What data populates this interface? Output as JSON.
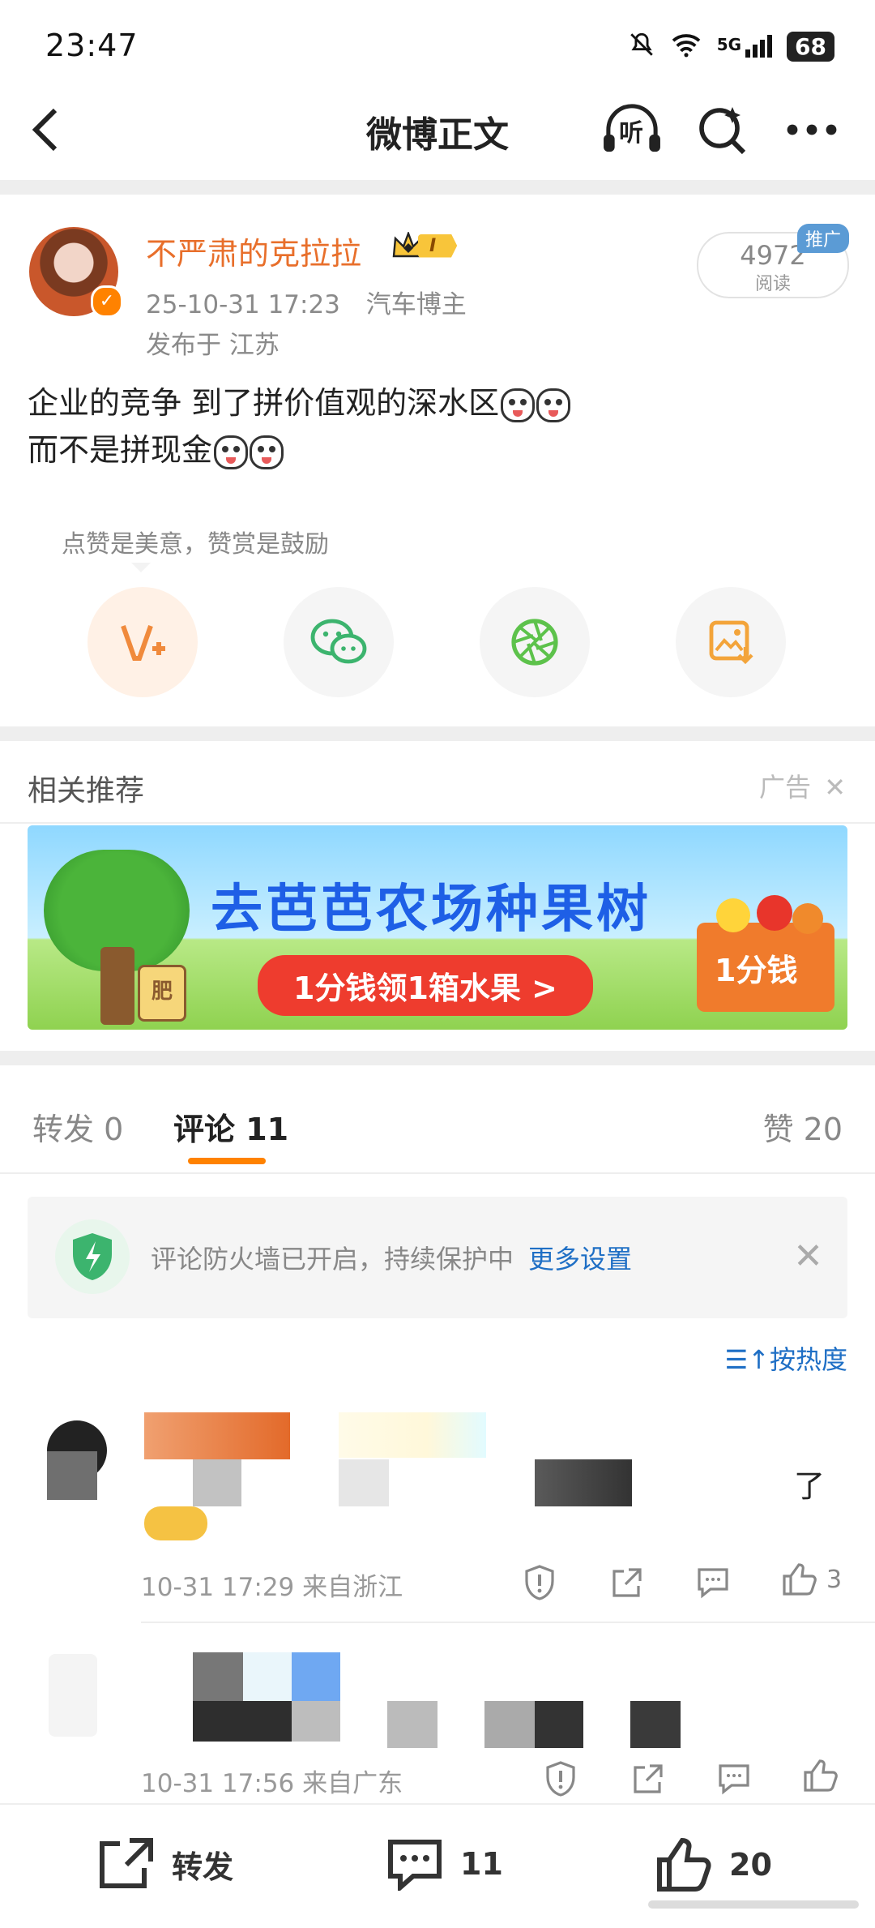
{
  "status_bar": {
    "time": "23:47",
    "network": "5G",
    "battery": "68"
  },
  "nav": {
    "title": "微博正文",
    "listen_label": "听"
  },
  "post": {
    "username": "不严肃的克拉拉",
    "rank_badge": "I",
    "date": "25-10-31 17:23",
    "role": "汽车博主",
    "location": "发布于 江苏",
    "reads": "4972",
    "reads_label": "阅读",
    "promo_tag": "推广",
    "text_line1": "企业的竞争 到了拼价值观的深水区",
    "text_line2": "而不是拼现金",
    "tip": "点赞是美意，赞赏是鼓励"
  },
  "related": {
    "title": "相关推荐",
    "ad_label": "广告",
    "banner_title": "去芭芭农场种果树",
    "banner_button": "1分钱领1箱水果 >",
    "banner_box": "1分钱",
    "banner_pot_label": "肥"
  },
  "tabs": {
    "repost": "转发 0",
    "comments": "评论 11",
    "likes": "赞 20"
  },
  "firewall": {
    "text": "评论防火墙已开启，持续保护中",
    "link": "更多设置"
  },
  "sort_label": "按热度",
  "comments": [
    {
      "meta": "10-31 17:29  来自浙江",
      "likes": "3",
      "trailing_text": "了"
    },
    {
      "meta": "10-31 17:56  来自广东",
      "likes": ""
    }
  ],
  "bottom_bar": {
    "repost": "转发",
    "comments": "11",
    "likes": "20"
  },
  "colors": {
    "accent_orange": "#ff8200",
    "username_orange": "#e86f2b",
    "link_blue": "#1f6fc5",
    "firewall_green": "#3cb46e"
  }
}
